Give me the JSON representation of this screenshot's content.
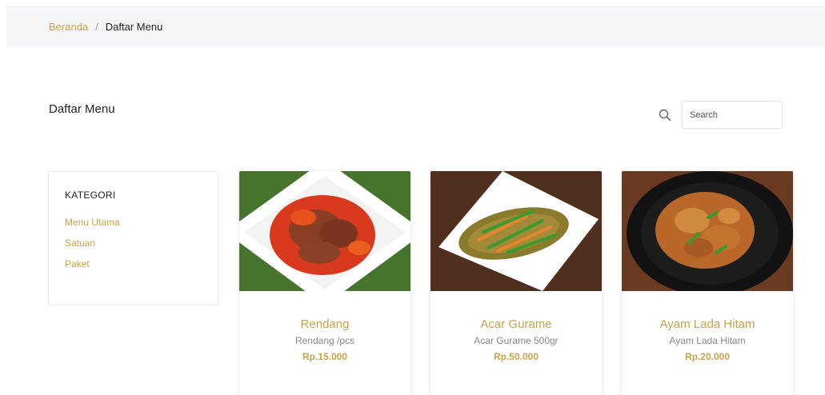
{
  "breadcrumb": {
    "home": "Beranda",
    "separator": "/",
    "current": "Daftar Menu"
  },
  "page": {
    "title": "Daftar Menu"
  },
  "search": {
    "placeholder": "Search",
    "value": ""
  },
  "sidebar": {
    "title": "KATEGORI",
    "items": [
      {
        "label": "Menu Utama"
      },
      {
        "label": "Satuan"
      },
      {
        "label": "Paket"
      }
    ]
  },
  "menu": {
    "items": [
      {
        "name": "Rendang",
        "description": "Rendang /pcs",
        "price": "Rp.15.000",
        "image": "rendang-photo"
      },
      {
        "name": "Acar Gurame",
        "description": "Acar Gurame 500gr",
        "price": "Rp.50.000",
        "image": "acar-gurame-photo"
      },
      {
        "name": "Ayam Lada Hitam",
        "description": "Ayam Lada Hitam",
        "price": "Rp.20.000",
        "image": "ayam-lada-hitam-photo"
      }
    ]
  },
  "colors": {
    "accent": "#c9a24a",
    "breadcrumb_bg": "#f5f6f8",
    "text": "#222222",
    "muted": "#888888"
  }
}
